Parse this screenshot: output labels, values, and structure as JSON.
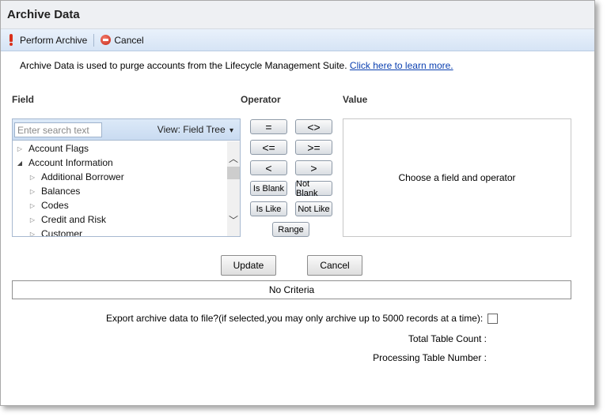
{
  "window": {
    "title": "Archive Data"
  },
  "toolbar": {
    "perform_label": "Perform Archive",
    "cancel_label": "Cancel"
  },
  "intro": {
    "text": "Archive Data is used to purge accounts from the Lifecycle Management Suite.",
    "link": "Click here to learn more."
  },
  "headers": {
    "field": "Field",
    "operator": "Operator",
    "value": "Value"
  },
  "search": {
    "placeholder": "Enter search text"
  },
  "view": {
    "label": "View: Field Tree",
    "caret": "▾"
  },
  "tree": {
    "items": [
      {
        "label": "Account Flags",
        "marker": "▷"
      },
      {
        "label": "Account Information",
        "marker": "◢"
      },
      {
        "label": "Additional Borrower",
        "marker": "▷"
      },
      {
        "label": "Balances",
        "marker": "▷"
      },
      {
        "label": "Codes",
        "marker": "▷"
      },
      {
        "label": "Credit and Risk",
        "marker": "▷"
      },
      {
        "label": "Customer",
        "marker": "▷"
      }
    ],
    "scroll_up": "︿",
    "scroll_down": "﹀"
  },
  "operators": {
    "eq": "=",
    "ne": "<>",
    "le": "<=",
    "ge": ">=",
    "lt": "<",
    "gt": ">",
    "is_blank": "Is Blank",
    "not_blank": "Not Blank",
    "is_like": "Is Like",
    "not_like": "Not Like",
    "range": "Range"
  },
  "value": {
    "message": "Choose a field and operator"
  },
  "actions": {
    "update": "Update",
    "cancel": "Cancel"
  },
  "criteria": {
    "text": "No Criteria"
  },
  "export": {
    "label": "Export archive data to file?(if selected,you may only archive up to 5000 records at a time):",
    "checked": false
  },
  "totals": {
    "table_count_label": "Total Table Count :",
    "processing_label": "Processing Table Number :"
  },
  "colors": {
    "link": "#0a3fb0",
    "toolbar_bg": "#d6e4f5",
    "danger": "#d9301b"
  },
  "icons": {
    "perform": "exclamation-icon",
    "cancel": "cancel-circle-icon"
  }
}
